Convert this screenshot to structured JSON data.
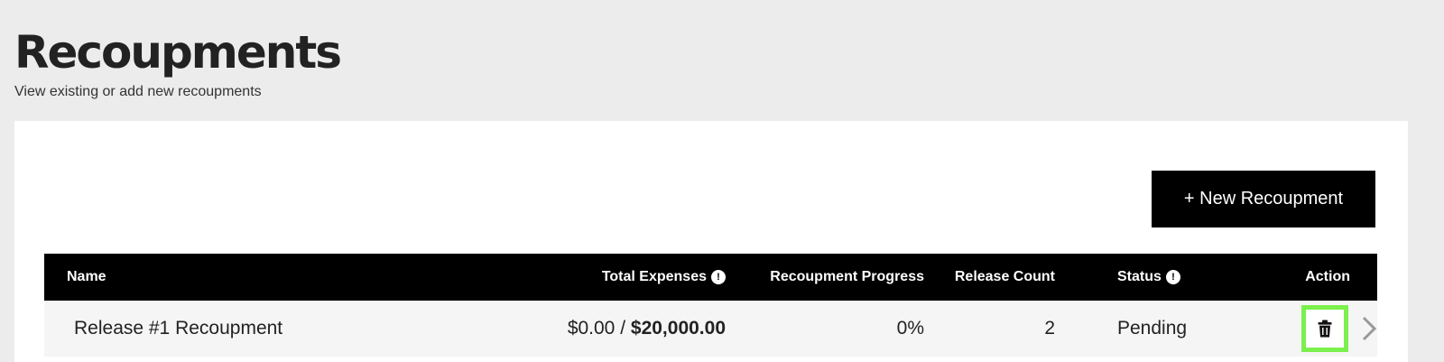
{
  "header": {
    "title": "Recoupments",
    "subtitle": "View existing or add new recoupments"
  },
  "toolbar": {
    "new_label": "+ New Recoupment"
  },
  "table": {
    "columns": {
      "name": "Name",
      "total_expenses": "Total Expenses",
      "progress": "Recoupment Progress",
      "release_count": "Release Count",
      "status": "Status",
      "action": "Action"
    },
    "info_glyph": "!",
    "rows": [
      {
        "name": "Release #1 Recoupment",
        "expenses_recouped": "$0.00",
        "expenses_separator": " / ",
        "expenses_total": "$20,000.00",
        "progress": "0%",
        "release_count": "2",
        "status": "Pending"
      }
    ]
  },
  "icons": {
    "info": "info-icon",
    "delete": "trash-icon",
    "open": "chevron-right-icon"
  },
  "colors": {
    "page_background": "#ececec",
    "header_background": "#000000",
    "row_background": "#f5f5f5",
    "highlight": "#7cf04d"
  }
}
